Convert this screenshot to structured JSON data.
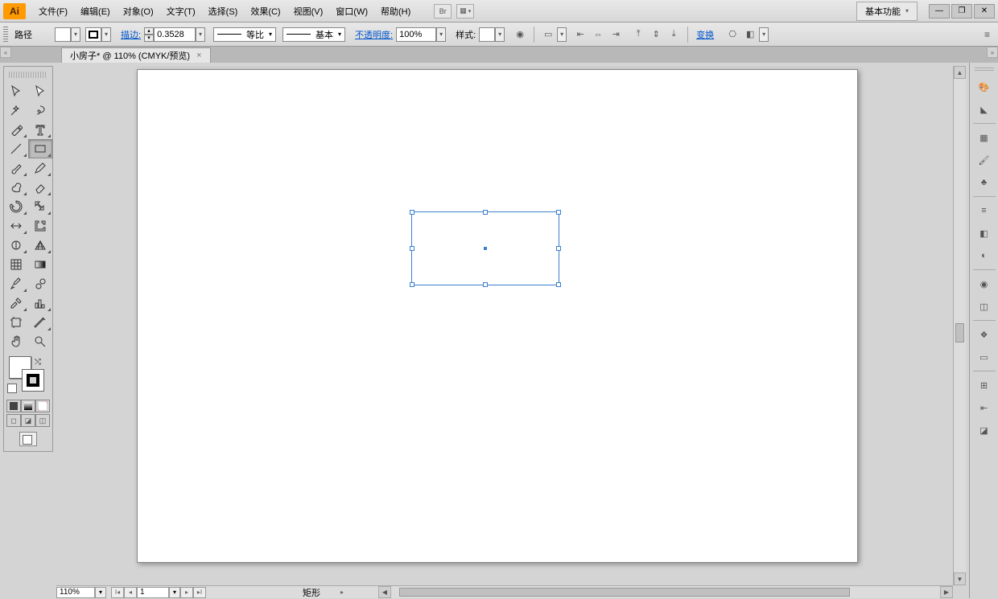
{
  "menubar": {
    "logo": "Ai",
    "items": [
      "文件(F)",
      "编辑(E)",
      "对象(O)",
      "文字(T)",
      "选择(S)",
      "效果(C)",
      "视图(V)",
      "窗口(W)",
      "帮助(H)"
    ],
    "bridge": "Br",
    "workspace": "基本功能"
  },
  "control": {
    "object_label": "路径",
    "stroke_label": "描边:",
    "stroke_weight": "0.3528",
    "profile_label": "等比",
    "brush_label": "基本",
    "opacity_label": "不透明度:",
    "opacity_value": "100%",
    "style_label": "样式:",
    "transform_label": "变换"
  },
  "tab": {
    "title": "小房子* @ 110% (CMYK/预览)",
    "close": "×"
  },
  "status": {
    "zoom": "110%",
    "artboard": "1",
    "selection": "矩形"
  },
  "tools": {
    "names": [
      "selection-tool",
      "direct-selection-tool",
      "magic-wand-tool",
      "lasso-tool",
      "pen-tool",
      "type-tool",
      "line-segment-tool",
      "rectangle-tool",
      "paintbrush-tool",
      "pencil-tool",
      "blob-brush-tool",
      "eraser-tool",
      "rotate-tool",
      "scale-tool",
      "width-tool",
      "free-transform-tool",
      "shape-builder-tool",
      "perspective-grid-tool",
      "mesh-tool",
      "gradient-tool",
      "eyedropper-tool",
      "blend-tool",
      "symbol-sprayer-tool",
      "column-graph-tool",
      "artboard-tool",
      "slice-tool",
      "hand-tool",
      "zoom-tool"
    ]
  },
  "right_panels": [
    "color-panel",
    "color-guide-panel",
    "swatches-panel",
    "brushes-panel",
    "symbols-panel",
    "stroke-panel",
    "gradient-panel",
    "transparency-panel",
    "appearance-panel",
    "graphic-styles-panel",
    "layers-panel",
    "artboards-panel",
    "transform-panel",
    "align-panel",
    "pathfinder-panel"
  ]
}
